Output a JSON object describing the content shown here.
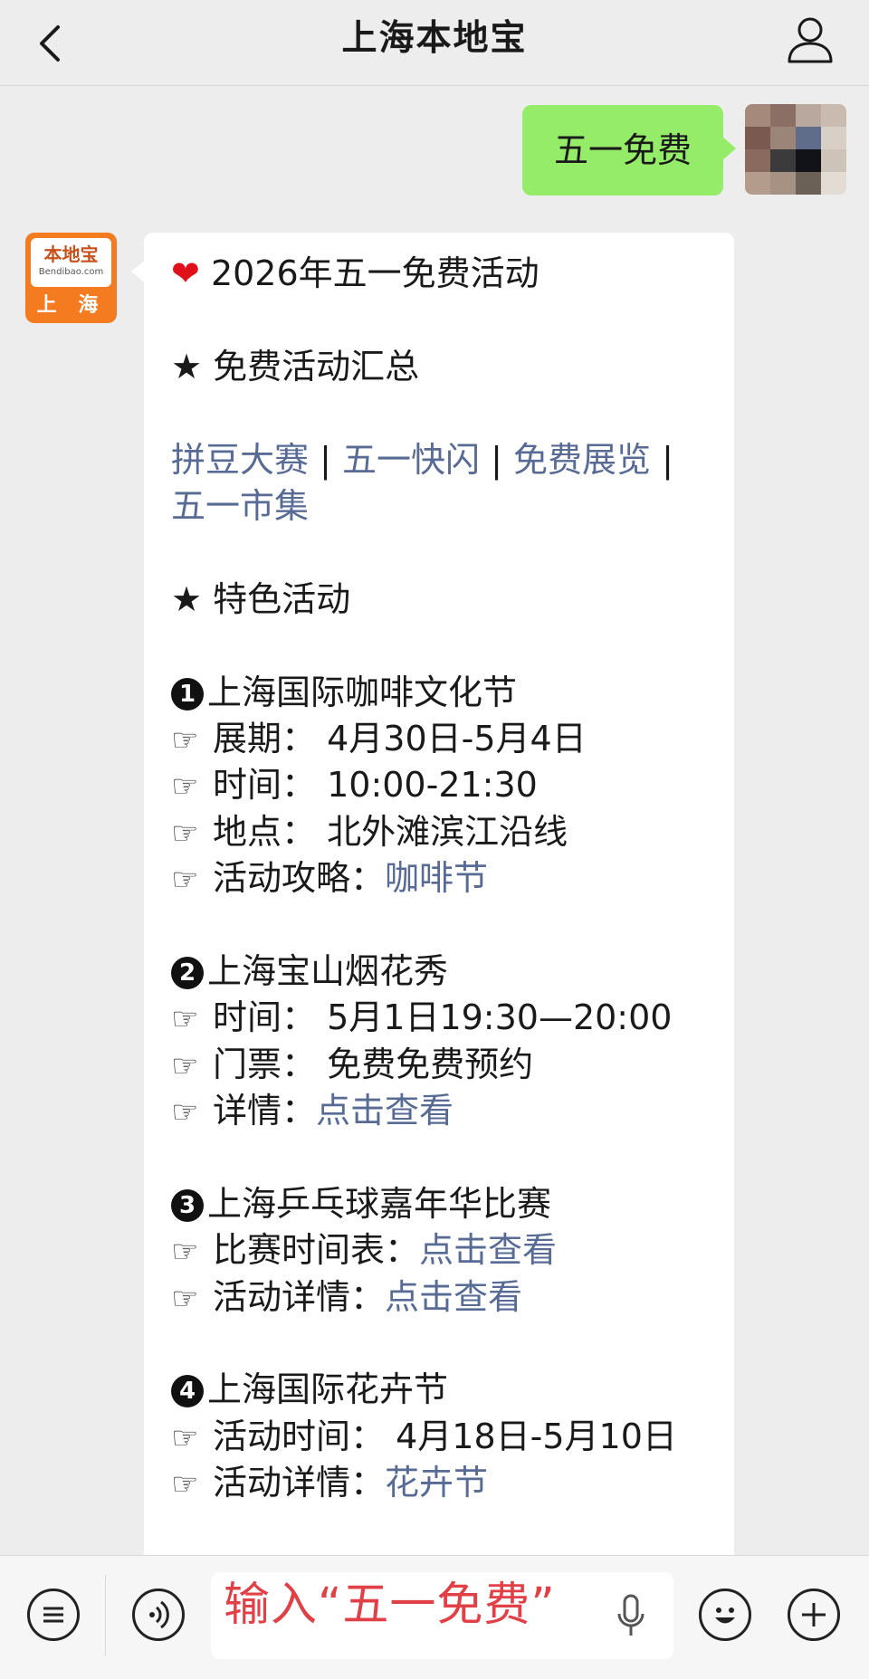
{
  "header": {
    "title": "上海本地宝"
  },
  "outgoing": {
    "text": "五一免费"
  },
  "incoming": {
    "avatar": {
      "logo_cn": "本地宝",
      "logo_en": "Bendibao.com",
      "city": "上 海"
    },
    "title_line": "2026年五一免费活动",
    "section1": "★ 免费活动汇总",
    "links_row1": [
      "拼豆大赛",
      "五一快闪",
      "免费展览"
    ],
    "links_row2": "五一市集",
    "section2": "★ 特色活动",
    "events": [
      {
        "num": "1",
        "title": "上海国际咖啡文化节",
        "lines": [
          {
            "label": "展期：",
            "value": " 4月30日-5月4日",
            "link": ""
          },
          {
            "label": "时间：",
            "value": " 10:00-21:30",
            "link": ""
          },
          {
            "label": "地点：",
            "value": " 北外滩滨江沿线",
            "link": ""
          },
          {
            "label": "活动攻略：",
            "value": "",
            "link": "咖啡节"
          }
        ]
      },
      {
        "num": "2",
        "title": "上海宝山烟花秀",
        "lines": [
          {
            "label": "时间：",
            "value": " 5月1日19:30—20:00",
            "link": ""
          },
          {
            "label": "门票：",
            "value": " 免费免费预约",
            "link": ""
          },
          {
            "label": "详情：",
            "value": "",
            "link": "点击查看"
          }
        ]
      },
      {
        "num": "3",
        "title": "上海乒乓球嘉年华比赛",
        "lines": [
          {
            "label": "比赛时间表：",
            "value": "",
            "link": "点击查看"
          },
          {
            "label": "活动详情：",
            "value": "",
            "link": "点击查看"
          }
        ]
      },
      {
        "num": "4",
        "title": "上海国际花卉节",
        "lines": [
          {
            "label": "活动时间：",
            "value": " 4月18日-5月10日",
            "link": ""
          },
          {
            "label": "活动详情：",
            "value": "",
            "link": "花卉节"
          }
        ]
      }
    ]
  },
  "input": {
    "value": "输入“五一免费”"
  },
  "icons": {
    "back": "chevron-left-icon",
    "user": "user-icon",
    "menu": "list-icon",
    "voice": "voice-icon",
    "mic": "mic-icon",
    "emoji": "emoji-icon",
    "plus": "plus-icon",
    "hand": "☞",
    "heart": "❤"
  },
  "colors": {
    "link": "#576b95",
    "out_bubble": "#95ec69",
    "input_text": "#e04046",
    "logo": "#f47b20"
  }
}
